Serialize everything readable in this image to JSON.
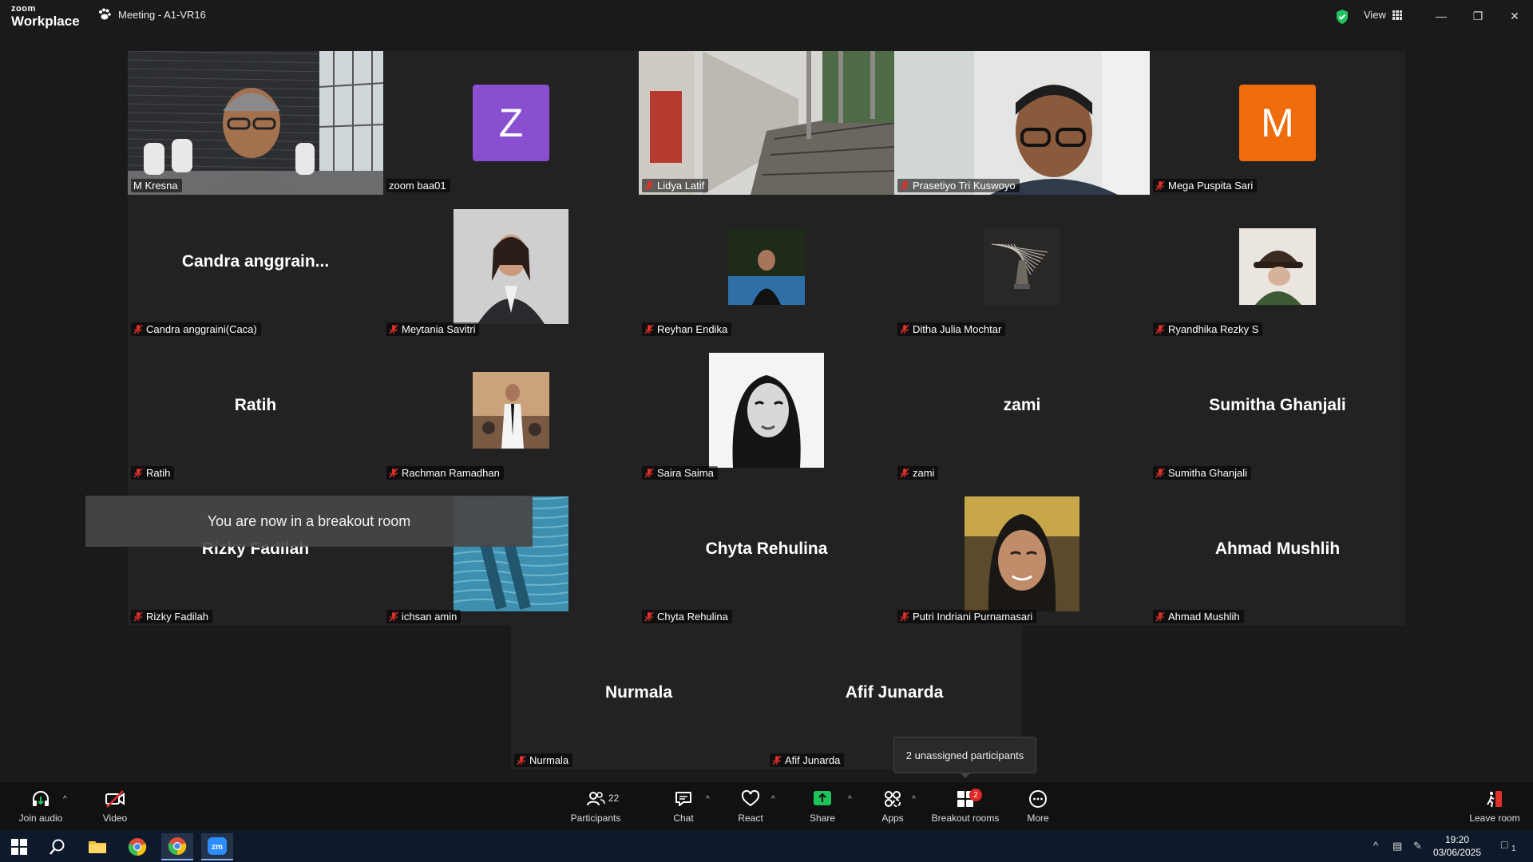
{
  "app": {
    "logo_top": "zoom",
    "logo_bottom": "Workplace",
    "meeting_title": "Meeting - A1-VR16",
    "view_label": "View"
  },
  "participants": [
    {
      "name": "M Kresna",
      "label": "M Kresna",
      "muted": false,
      "kind": "video-office",
      "active": true
    },
    {
      "name": "zoom baa01",
      "label": "zoom baa01",
      "muted": false,
      "kind": "letter",
      "letter": "Z",
      "color": "#8a4fd0"
    },
    {
      "name": "Lidya Latif",
      "label": "Lidya Latif",
      "muted": true,
      "kind": "video-station"
    },
    {
      "name": "Prasetiyo Tri Kuswoyo",
      "label": "Prasetiyo Tri Kuswoyo",
      "muted": true,
      "kind": "video-person"
    },
    {
      "name": "Mega Puspita Sari",
      "label": "Mega Puspita Sari",
      "muted": true,
      "kind": "letter",
      "letter": "M",
      "color": "#ef6c0c"
    },
    {
      "name": "Candra anggrain...",
      "label": "Candra anggraini(Caca)",
      "muted": true,
      "kind": "name"
    },
    {
      "name": "Meytania Savitri",
      "label": "Meytania Savitri",
      "muted": true,
      "kind": "photo-large"
    },
    {
      "name": "Reyhan Endika",
      "label": "Reyhan Endika",
      "muted": true,
      "kind": "photo-small"
    },
    {
      "name": "Ditha Julia Mochtar",
      "label": "Ditha Julia Mochtar",
      "muted": true,
      "kind": "photo-small"
    },
    {
      "name": "Ryandhika Rezky S",
      "label": "Ryandhika Rezky S",
      "muted": true,
      "kind": "photo-small"
    },
    {
      "name": "Ratih",
      "label": "Ratih",
      "muted": true,
      "kind": "name"
    },
    {
      "name": "Rachman Ramadhan",
      "label": "Rachman Ramadhan",
      "muted": true,
      "kind": "photo-small"
    },
    {
      "name": "Saira Saima",
      "label": "Saira Saima",
      "muted": true,
      "kind": "photo-large"
    },
    {
      "name": "zami",
      "label": "zami",
      "muted": true,
      "kind": "name"
    },
    {
      "name": "Sumitha Ghanjali",
      "label": "Sumitha Ghanjali",
      "muted": true,
      "kind": "name"
    },
    {
      "name": "Rizky Fadilah",
      "label": "Rizky Fadilah",
      "muted": true,
      "kind": "name"
    },
    {
      "name": "ichsan amin",
      "label": "ichsan amin",
      "muted": true,
      "kind": "photo-large"
    },
    {
      "name": "Chyta Rehulina",
      "label": "Chyta Rehulina",
      "muted": true,
      "kind": "name"
    },
    {
      "name": "Putri Indriani Purnamasari",
      "label": "Putri Indriani Purnamasari",
      "muted": true,
      "kind": "photo-large"
    },
    {
      "name": "Ahmad Mushlih",
      "label": "Ahmad Mushlih",
      "muted": true,
      "kind": "name"
    },
    {
      "name": "Nurmala",
      "label": "Nurmala",
      "muted": true,
      "kind": "name"
    },
    {
      "name": "Afif Junarda",
      "label": "Afif Junarda",
      "muted": true,
      "kind": "name"
    }
  ],
  "toast": "You are now in a breakout room",
  "tooltip": "2 unassigned participants",
  "toolbar": {
    "join_audio": "Join audio",
    "video": "Video",
    "participants": "Participants",
    "participants_count": "22",
    "chat": "Chat",
    "react": "React",
    "share": "Share",
    "apps": "Apps",
    "breakout_rooms": "Breakout rooms",
    "breakout_badge": "2",
    "more": "More",
    "leave_room": "Leave room"
  },
  "taskbar": {
    "time": "19:20",
    "date": "03/06/2025",
    "notification_count": "1"
  },
  "colors": {
    "accent_green": "#22c38e",
    "share_green": "#1ec35a",
    "muted_red": "#e0302c"
  }
}
